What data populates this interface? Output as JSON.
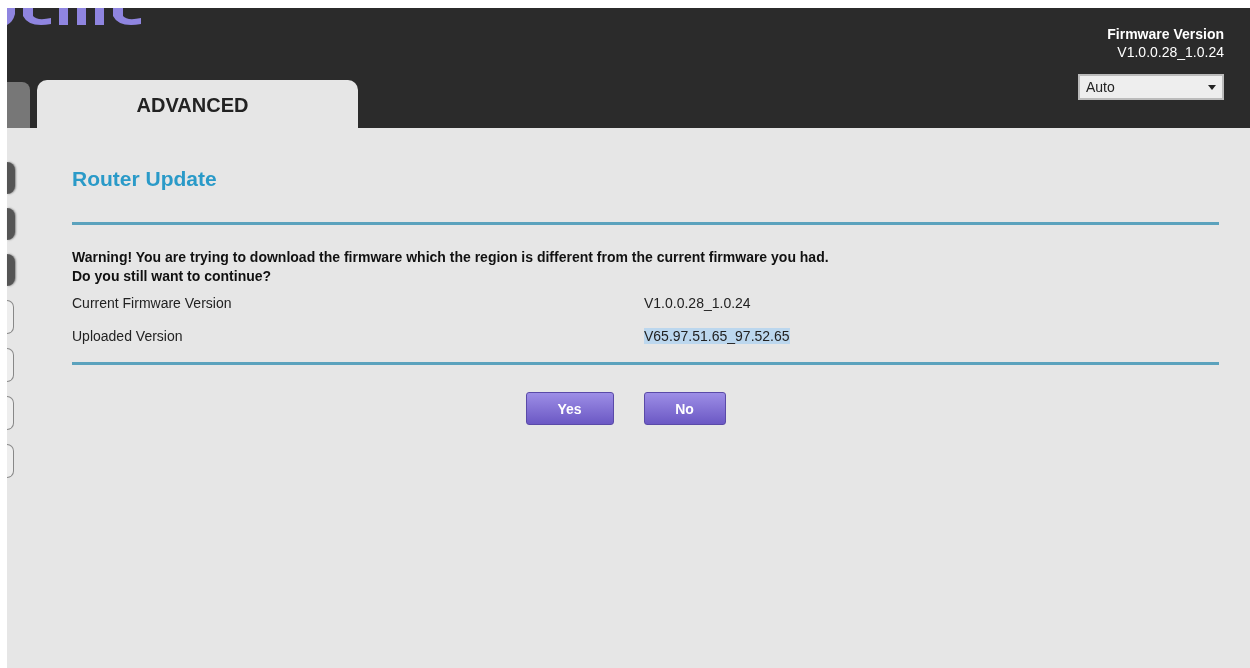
{
  "header": {
    "firmware_label": "Firmware Version",
    "firmware_version": "V1.0.0.28_1.0.24",
    "language_select": {
      "value": "Auto"
    }
  },
  "tabs": [
    {
      "label": "ADVANCED",
      "selected": true
    }
  ],
  "side_menu": [
    {
      "kind": "dark"
    },
    {
      "kind": "dark"
    },
    {
      "kind": "dark"
    },
    {
      "kind": "light"
    },
    {
      "kind": "light"
    },
    {
      "kind": "light"
    },
    {
      "kind": "light"
    }
  ],
  "panel": {
    "title": "Router Update",
    "warning": "Warning! You are trying to download the firmware which the region is different from the current firmware you had.\nDo you still want to continue?",
    "rows": [
      {
        "label": "Current Firmware Version",
        "value": "V1.0.0.28_1.0.24",
        "highlighted": false
      },
      {
        "label": "Uploaded Version",
        "value": "V65.97.51.65_97.52.65",
        "highlighted": true
      }
    ],
    "buttons": [
      "Yes",
      "No"
    ]
  }
}
